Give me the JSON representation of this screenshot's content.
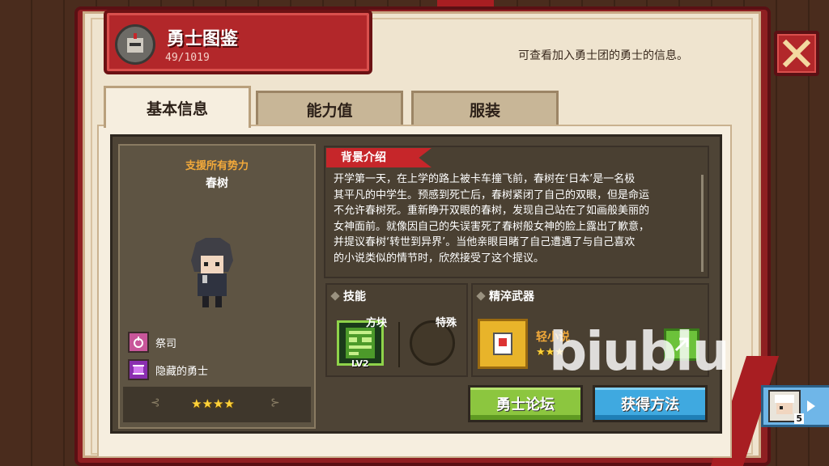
{
  "header": {
    "title": "勇士图鉴",
    "count": "49/1019",
    "description": "可查看加入勇士团的勇士的信息。"
  },
  "tabs": [
    {
      "label": "基本信息",
      "active": true
    },
    {
      "label": "能力值",
      "active": false
    },
    {
      "label": "服装",
      "active": false
    }
  ],
  "hero": {
    "faction": "支援所有势力",
    "name": "春树",
    "classes": [
      {
        "label": "祭司",
        "icon": "priest-icon"
      },
      {
        "label": "隐藏的勇士",
        "icon": "scroll-icon"
      }
    ],
    "stars": "★★★★"
  },
  "story": {
    "title": "背景介绍",
    "lines": [
      "开学第一天，在上学的路上被卡车撞飞前，春树在‘日本’是一名极",
      "其平凡的中学生。预感到死亡后，春树紧闭了自己的双眼，但是命运",
      "不允许春树死。重新睁开双眼的春树，发现自己站在了如画般美丽的",
      "女神面前。就像因自己的失误害死了春树般女神的脸上露出了歉意，",
      "并提议春树‘转世到异界’。当他亲眼目睹了自己遭遇了与自己喜欢",
      "的小说类似的情节时，欣然接受了这个提议。"
    ]
  },
  "skills": {
    "title": "技能",
    "block_label": "方块",
    "block_level": "LV2",
    "special_label": "特殊"
  },
  "weapon": {
    "title": "精淬武器",
    "name": "轻小说",
    "stars": "★★★"
  },
  "buttons": {
    "forum": "勇士论坛",
    "obtain": "获得方法"
  },
  "next_hero": {
    "level": "5"
  },
  "watermark": "biublu",
  "colors": {
    "book_red": "#b2272a",
    "page": "#efe4cf",
    "panel_dark": "#4e4436",
    "accent_orange": "#f2a93a",
    "green_button": "#8cc63f",
    "blue_button": "#3fa9e0"
  }
}
